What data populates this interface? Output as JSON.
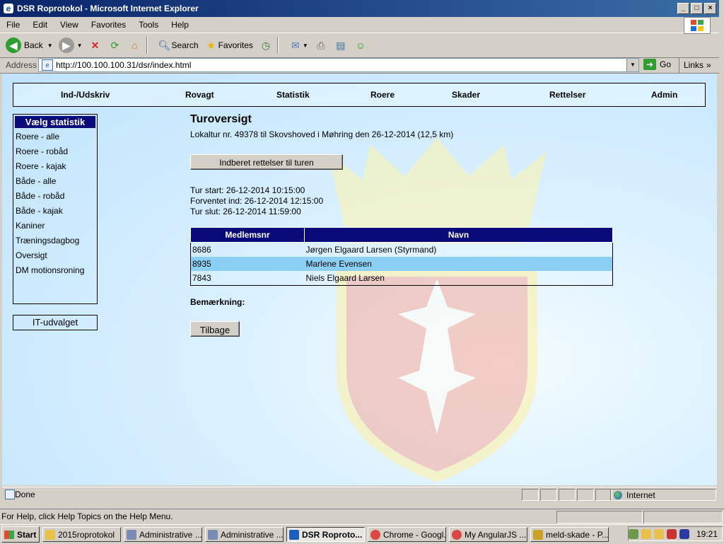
{
  "window": {
    "title": "DSR Roprotokol - Microsoft Internet Explorer",
    "buttons": [
      "_",
      "□",
      "×"
    ]
  },
  "menu": [
    "File",
    "Edit",
    "View",
    "Favorites",
    "Tools",
    "Help"
  ],
  "toolbar": {
    "back": "Back",
    "search": "Search",
    "favorites": "Favorites"
  },
  "address": {
    "label": "Address",
    "url": "http://100.100.100.31/dsr/index.html",
    "go": "Go",
    "links": "Links"
  },
  "nav": [
    "Ind-/Udskriv",
    "Rovagt",
    "Statistik",
    "Roere",
    "Skader",
    "Rettelser",
    "Admin"
  ],
  "sidebar": {
    "header": "Vælg statistik",
    "items": [
      "Roere - alle",
      "Roere - robåd",
      "Roere - kajak",
      "Både - alle",
      "Både - robåd",
      "Både - kajak",
      "Kaniner",
      "Træningsdagbog",
      "Oversigt",
      "DM motionsroning"
    ],
    "it_button": "IT-udvalget"
  },
  "main": {
    "title": "Turoversigt",
    "subtitle": "Lokaltur nr. 49378 til Skovshoved i Møhring den 26-12-2014 (12,5 km)",
    "report_button": "Indberet rettelser til turen",
    "times": {
      "start": "Tur start: 26-12-2014 10:15:00",
      "expected": "Forventet ind: 26-12-2014 12:15:00",
      "end": "Tur slut: 26-12-2014 11:59:00"
    },
    "table": {
      "headers": [
        "Medlemsnr",
        "Navn"
      ],
      "rows": [
        {
          "nr": "8686",
          "name": "Jørgen Elgaard Larsen (Styrmand)"
        },
        {
          "nr": "8935",
          "name": "Marlene Evensen"
        },
        {
          "nr": "7843",
          "name": "Niels Elgaard Larsen"
        }
      ],
      "selected_row": 1
    },
    "remark_label": "Bemærkning:",
    "back_button": "Tilbage"
  },
  "status": {
    "text": "Done",
    "zone": "Internet",
    "help": "For Help, click Help Topics on the Help Menu."
  },
  "taskbar": {
    "start": "Start",
    "tasks": [
      {
        "label": "2015roprotokol",
        "color": "#e8c04a"
      },
      {
        "label": "Administrative ...",
        "color": "#7a8bb5"
      },
      {
        "label": "Administrative ...",
        "color": "#7a8bb5"
      },
      {
        "label": "DSR Roproto...",
        "color": "#1d5fbf",
        "active": true
      },
      {
        "label": "Chrome - Googl...",
        "color": "#d44"
      },
      {
        "label": "My AngularJS ...",
        "color": "#d44"
      },
      {
        "label": "meld-skade - P...",
        "color": "#c9a227"
      }
    ],
    "clock": "19:21"
  }
}
